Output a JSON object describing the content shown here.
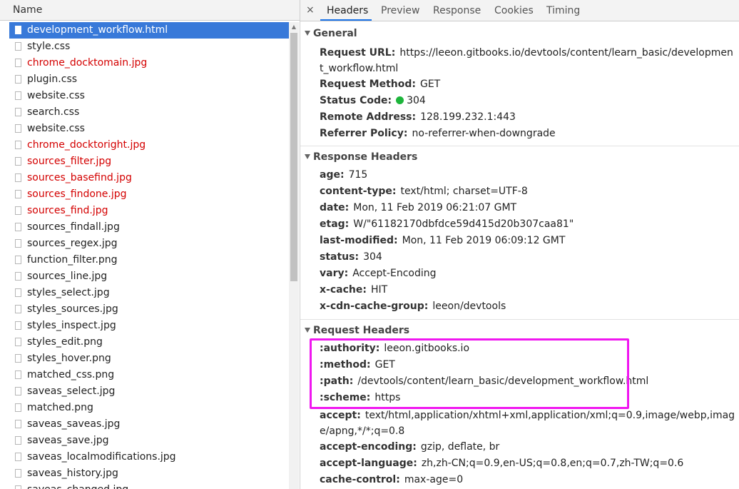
{
  "list": {
    "header": "Name",
    "items": [
      {
        "name": "development_workflow.html",
        "status": "selected"
      },
      {
        "name": "style.css",
        "status": "ok"
      },
      {
        "name": "chrome_docktomain.jpg",
        "status": "error"
      },
      {
        "name": "plugin.css",
        "status": "ok"
      },
      {
        "name": "website.css",
        "status": "ok"
      },
      {
        "name": "search.css",
        "status": "ok"
      },
      {
        "name": "website.css",
        "status": "ok"
      },
      {
        "name": "chrome_docktoright.jpg",
        "status": "error"
      },
      {
        "name": "sources_filter.jpg",
        "status": "error"
      },
      {
        "name": "sources_basefind.jpg",
        "status": "error"
      },
      {
        "name": "sources_findone.jpg",
        "status": "error"
      },
      {
        "name": "sources_find.jpg",
        "status": "error"
      },
      {
        "name": "sources_findall.jpg",
        "status": "ok"
      },
      {
        "name": "sources_regex.jpg",
        "status": "ok"
      },
      {
        "name": "function_filter.png",
        "status": "ok"
      },
      {
        "name": "sources_line.jpg",
        "status": "ok"
      },
      {
        "name": "styles_select.jpg",
        "status": "ok"
      },
      {
        "name": "styles_sources.jpg",
        "status": "ok"
      },
      {
        "name": "styles_inspect.jpg",
        "status": "ok"
      },
      {
        "name": "styles_edit.png",
        "status": "ok"
      },
      {
        "name": "styles_hover.png",
        "status": "ok"
      },
      {
        "name": "matched_css.png",
        "status": "ok"
      },
      {
        "name": "saveas_select.jpg",
        "status": "ok"
      },
      {
        "name": "matched.png",
        "status": "ok"
      },
      {
        "name": "saveas_saveas.jpg",
        "status": "ok"
      },
      {
        "name": "saveas_save.jpg",
        "status": "ok"
      },
      {
        "name": "saveas_localmodifications.jpg",
        "status": "ok"
      },
      {
        "name": "saveas_history.jpg",
        "status": "ok"
      },
      {
        "name": "saveas_changed.jpg",
        "status": "ok"
      }
    ]
  },
  "tabs": {
    "close": "×",
    "items": [
      "Headers",
      "Preview",
      "Response",
      "Cookies",
      "Timing"
    ],
    "active": "Headers"
  },
  "colors": {
    "error_text": "#d40000",
    "selected_bg": "#3879d9",
    "status_ok": "#1db53b",
    "highlight": "#f017f0"
  },
  "general": {
    "title": "General",
    "request_url_label": "Request URL:",
    "request_url": "https://leeon.gitbooks.io/devtools/content/learn_basic/development_workflow.html",
    "method_label": "Request Method:",
    "method": "GET",
    "status_label": "Status Code:",
    "status": "304",
    "remote_label": "Remote Address:",
    "remote": "128.199.232.1:443",
    "referrer_label": "Referrer Policy:",
    "referrer": "no-referrer-when-downgrade"
  },
  "response_headers": {
    "title": "Response Headers",
    "items": [
      {
        "k": "age:",
        "v": "715"
      },
      {
        "k": "content-type:",
        "v": "text/html; charset=UTF-8"
      },
      {
        "k": "date:",
        "v": "Mon, 11 Feb 2019 06:21:07 GMT"
      },
      {
        "k": "etag:",
        "v": "W/\"61182170dbfdce59d415d20b307caa81\""
      },
      {
        "k": "last-modified:",
        "v": "Mon, 11 Feb 2019 06:09:12 GMT"
      },
      {
        "k": "status:",
        "v": "304"
      },
      {
        "k": "vary:",
        "v": "Accept-Encoding"
      },
      {
        "k": "x-cache:",
        "v": "HIT"
      },
      {
        "k": "x-cdn-cache-group:",
        "v": "leeon/devtools"
      }
    ]
  },
  "request_headers": {
    "title": "Request Headers",
    "items": [
      {
        "k": ":authority:",
        "v": "leeon.gitbooks.io"
      },
      {
        "k": ":method:",
        "v": "GET"
      },
      {
        "k": ":path:",
        "v": "/devtools/content/learn_basic/development_workflow.html"
      },
      {
        "k": ":scheme:",
        "v": "https"
      },
      {
        "k": "accept:",
        "v": "text/html,application/xhtml+xml,application/xml;q=0.9,image/webp,image/apng,*/*;q=0.8"
      },
      {
        "k": "accept-encoding:",
        "v": "gzip, deflate, br"
      },
      {
        "k": "accept-language:",
        "v": "zh,zh-CN;q=0.9,en-US;q=0.8,en;q=0.7,zh-TW;q=0.6"
      },
      {
        "k": "cache-control:",
        "v": "max-age=0"
      }
    ]
  }
}
